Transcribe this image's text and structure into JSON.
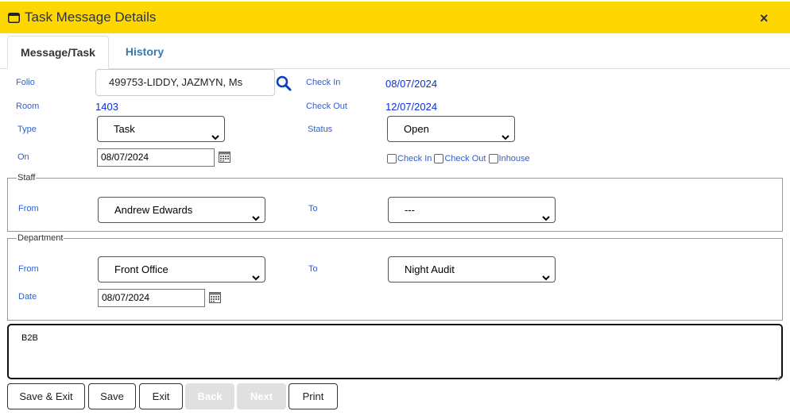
{
  "window": {
    "title": "Task Message Details",
    "icon": "window-icon",
    "close_label": "×"
  },
  "tabs": [
    {
      "label": "Message/Task",
      "active": true
    },
    {
      "label": "History",
      "active": false
    }
  ],
  "form": {
    "folio_label": "Folio",
    "folio_value": "499753-LIDDY, JAZMYN, Ms",
    "check_in_label": "Check In",
    "check_in_value": "08/07/2024",
    "room_label": "Room",
    "room_value": "1403",
    "check_out_label": "Check Out",
    "check_out_value": "12/07/2024",
    "type_label": "Type",
    "type_value": "Task",
    "status_label": "Status",
    "status_value": "Open",
    "on_label": "On",
    "on_value": "08/07/2024",
    "checkboxes": [
      {
        "label": "Check In",
        "checked": false
      },
      {
        "label": "Check Out",
        "checked": false
      },
      {
        "label": "Inhouse",
        "checked": false
      }
    ]
  },
  "staff": {
    "legend": "Staff",
    "from_label": "From",
    "from_value": "Andrew Edwards",
    "to_label": "To",
    "to_value": "---"
  },
  "department": {
    "legend": "Department",
    "from_label": "From",
    "from_value": "Front Office",
    "to_label": "To",
    "to_value": "Night Audit",
    "date_label": "Date",
    "date_value": "08/07/2024"
  },
  "message": {
    "text": "B2B"
  },
  "buttons": {
    "save_exit": "Save & Exit",
    "save": "Save",
    "exit": "Exit",
    "back": "Back",
    "next": "Next",
    "print": "Print"
  },
  "colors": {
    "titlebar": "#ffd700",
    "label": "#2f5fcc",
    "value": "#0a2fd6",
    "tab_link": "#337ab7"
  }
}
